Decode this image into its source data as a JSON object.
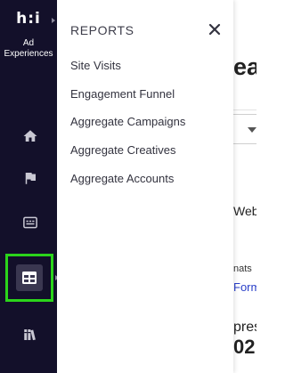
{
  "sidebar": {
    "logo_text": "h:i",
    "brand": "Ad Experiences",
    "items": [
      {
        "name": "home"
      },
      {
        "name": "flag"
      },
      {
        "name": "ad"
      },
      {
        "name": "reports",
        "active": true
      },
      {
        "name": "library"
      }
    ],
    "active_highlight_color": "#2bd41b"
  },
  "panel": {
    "title": "REPORTS",
    "close_icon": "close-icon",
    "items": [
      {
        "label": "Site Visits"
      },
      {
        "label": "Engagement Funnel"
      },
      {
        "label": "Aggregate Campaigns"
      },
      {
        "label": "Aggregate Creatives"
      },
      {
        "label": "Aggregate Accounts"
      }
    ]
  },
  "background_page": {
    "title_fragment": "ea",
    "web_fragment": "Web",
    "nats_fragment": "nats",
    "form_fragment": "Form",
    "pres_fragment": "pres",
    "number_fragment": "02",
    "mark_fragment": "⌄"
  },
  "colors": {
    "rail_bg": "#13102a",
    "link": "#2a3fc8"
  }
}
